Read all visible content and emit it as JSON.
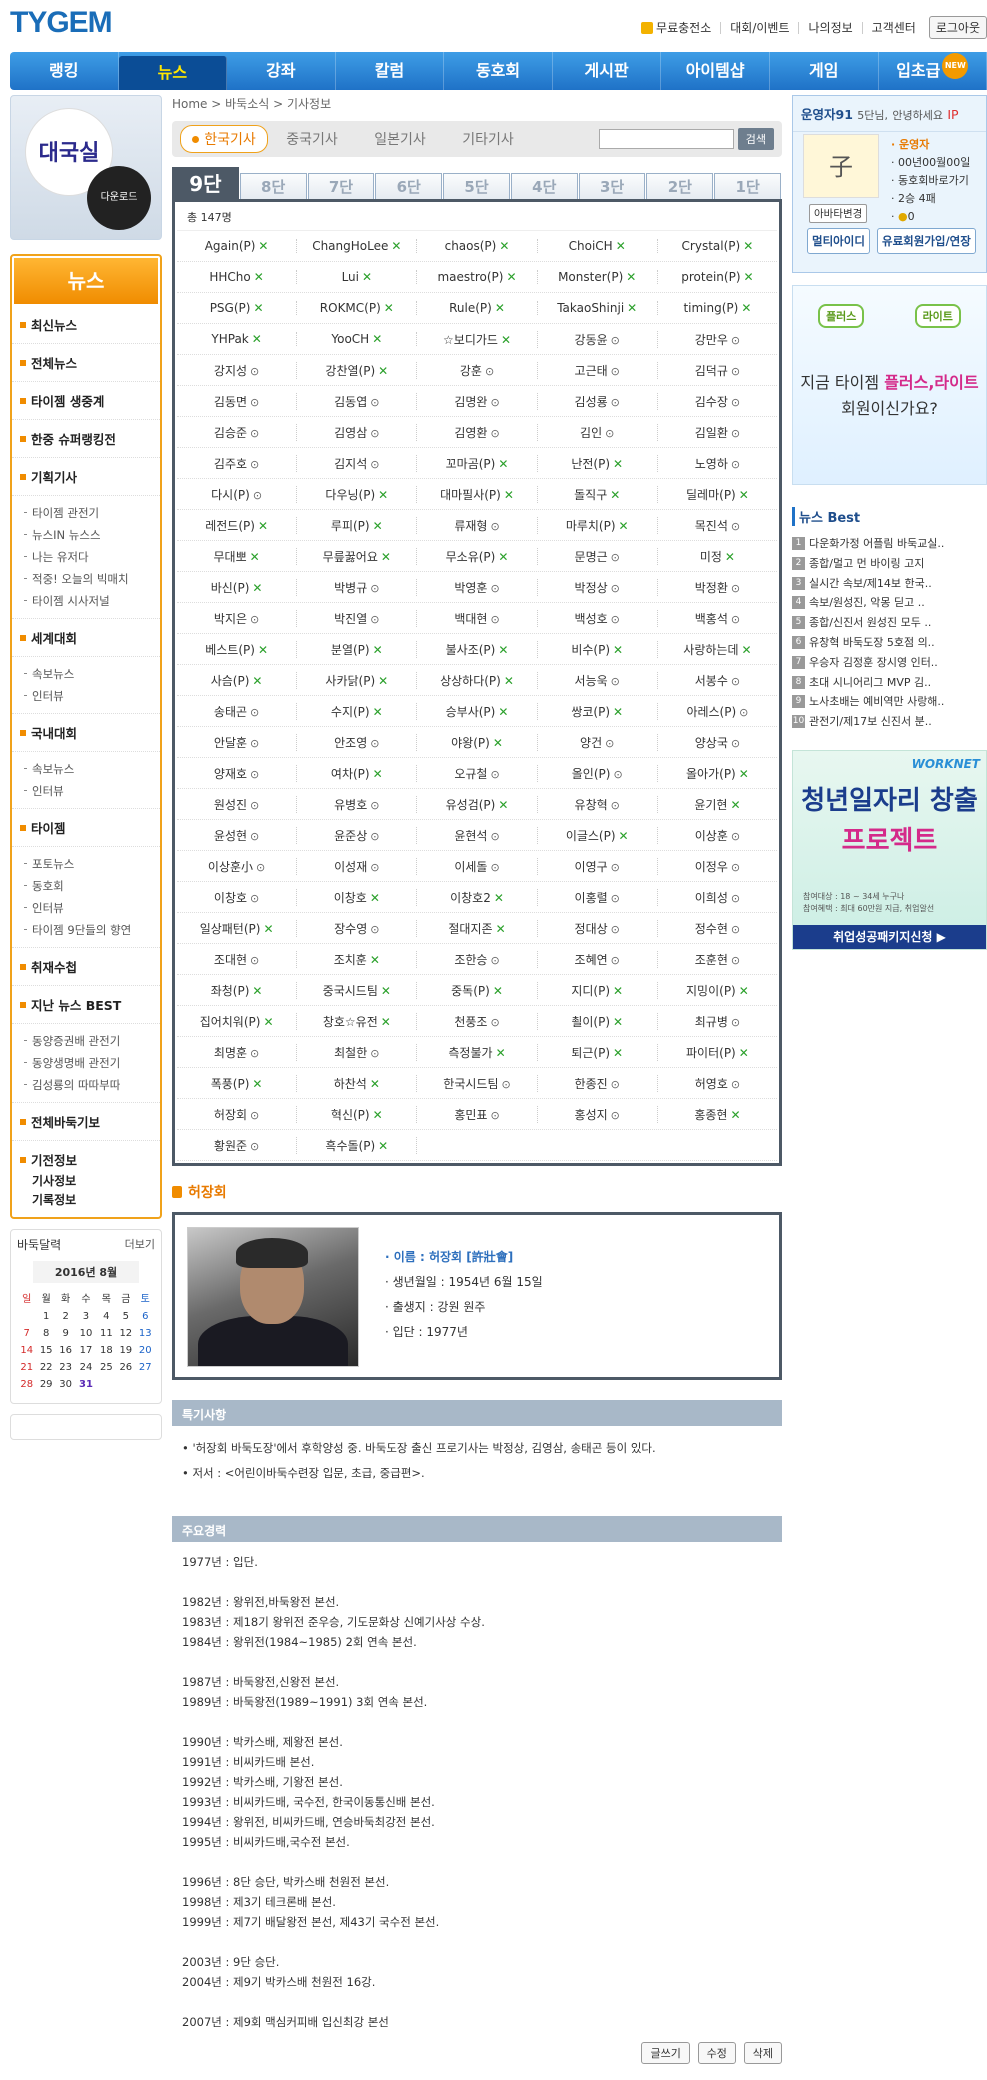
{
  "header": {
    "logo": "TYGEM",
    "links": [
      "무료충전소",
      "대회/이벤트",
      "나의정보",
      "고객센터"
    ],
    "login": "로그아웃"
  },
  "gnb": [
    "랭킹",
    "뉴스",
    "강좌",
    "칼럼",
    "동호회",
    "게시판",
    "아이템샵",
    "게임",
    "입초급"
  ],
  "gnb_new": "NEW",
  "left": {
    "daeguk_title": "대국실",
    "daeguk_download": "다운로드",
    "news_title": "뉴스",
    "categories": {
      "c1": "최신뉴스",
      "c2": "전체뉴스",
      "c3": "타이젬 생중계",
      "c4": "한중 슈퍼랭킹전",
      "c5": "기획기사",
      "c5_subs": [
        "타이젬 관전기",
        "뉴스IN 뉴스스",
        "나는 유저다",
        "적중! 오늘의 빅매치",
        "타이젬 시사저널"
      ],
      "c6": "세계대회",
      "c6_subs": [
        "속보뉴스",
        "인터뷰"
      ],
      "c7": "국내대회",
      "c7_subs": [
        "속보뉴스",
        "인터뷰"
      ],
      "c8": "타이젬",
      "c8_subs": [
        "포토뉴스",
        "동호회",
        "인터뷰",
        "타이젬 9단들의 향연"
      ],
      "c9": "취재수첩",
      "c10": "지난 뉴스 BEST",
      "c10_subs": [
        "동양증권배 관전기",
        "동양생명배 관전기",
        "김성룡의 따따부따"
      ],
      "c11": "전체바둑기보",
      "c12_items": [
        "기전정보",
        "기사정보",
        "기록정보"
      ]
    },
    "calendar": {
      "title": "바둑달력",
      "more": "더보기",
      "month": "2016년 8월",
      "weekdays": [
        "일",
        "월",
        "화",
        "수",
        "목",
        "금",
        "토"
      ],
      "weeks": [
        [
          "",
          "1",
          "2",
          "3",
          "4",
          "5",
          "6"
        ],
        [
          "7",
          "8",
          "9",
          "10",
          "11",
          "12",
          "13"
        ],
        [
          "14",
          "15",
          "16",
          "17",
          "18",
          "19",
          "20"
        ],
        [
          "21",
          "22",
          "23",
          "24",
          "25",
          "26",
          "27"
        ],
        [
          "28",
          "29",
          "30",
          "31",
          "",
          "",
          ""
        ]
      ]
    }
  },
  "main": {
    "breadcrumb": "Home > 바둑소식 > 기사정보",
    "country_tabs": [
      "한국기사",
      "중국기사",
      "일본기사",
      "기타기사"
    ],
    "search_button": "검색",
    "dan_tabs": [
      "9단",
      "8단",
      "7단",
      "6단",
      "5단",
      "4단",
      "3단",
      "2단",
      "1단"
    ],
    "total": "총 147명",
    "players": [
      [
        "Again(P)",
        "x"
      ],
      [
        "ChangHoLee",
        "x"
      ],
      [
        "chaos(P)",
        "x"
      ],
      [
        "ChoiCH",
        "x"
      ],
      [
        "Crystal(P)",
        "x"
      ],
      [
        "HHCho",
        "x"
      ],
      [
        "Lui",
        "x"
      ],
      [
        "maestro(P)",
        "x"
      ],
      [
        "Monster(P)",
        "x"
      ],
      [
        "protein(P)",
        "x"
      ],
      [
        "PSG(P)",
        "x"
      ],
      [
        "ROKMC(P)",
        "x"
      ],
      [
        "Rule(P)",
        "x"
      ],
      [
        "TakaoShinji",
        "x"
      ],
      [
        "timing(P)",
        "x"
      ],
      [
        "YHPak",
        "x"
      ],
      [
        "YooCH",
        "x"
      ],
      [
        "☆보디가드",
        "x"
      ],
      [
        "강동윤",
        "o"
      ],
      [
        "강만우",
        "o"
      ],
      [
        "강지성",
        "o"
      ],
      [
        "강찬열(P)",
        "x"
      ],
      [
        "강훈",
        "o"
      ],
      [
        "고근태",
        "o"
      ],
      [
        "김덕규",
        "o"
      ],
      [
        "김동면",
        "o"
      ],
      [
        "김동엽",
        "o"
      ],
      [
        "김명완",
        "o"
      ],
      [
        "김성룡",
        "o"
      ],
      [
        "김수장",
        "o"
      ],
      [
        "김승준",
        "o"
      ],
      [
        "김영삼",
        "o"
      ],
      [
        "김영환",
        "o"
      ],
      [
        "김인",
        "o"
      ],
      [
        "김일환",
        "o"
      ],
      [
        "김주호",
        "o"
      ],
      [
        "김지석",
        "o"
      ],
      [
        "꼬마곰(P)",
        "x"
      ],
      [
        "난전(P)",
        "x"
      ],
      [
        "노영하",
        "o"
      ],
      [
        "다시(P)",
        "o"
      ],
      [
        "다우닝(P)",
        "x"
      ],
      [
        "대마필사(P)",
        "x"
      ],
      [
        "돌직구",
        "x"
      ],
      [
        "딜레마(P)",
        "x"
      ],
      [
        "레전드(P)",
        "x"
      ],
      [
        "루피(P)",
        "x"
      ],
      [
        "류재형",
        "o"
      ],
      [
        "마루치(P)",
        "x"
      ],
      [
        "목진석",
        "o"
      ],
      [
        "무대뽀",
        "x"
      ],
      [
        "무릎꿇어요",
        "x"
      ],
      [
        "무소유(P)",
        "x"
      ],
      [
        "문명근",
        "o"
      ],
      [
        "미정",
        "x"
      ],
      [
        "바신(P)",
        "x"
      ],
      [
        "박병규",
        "o"
      ],
      [
        "박영훈",
        "o"
      ],
      [
        "박정상",
        "o"
      ],
      [
        "박정환",
        "o"
      ],
      [
        "박지은",
        "o"
      ],
      [
        "박진열",
        "o"
      ],
      [
        "백대현",
        "o"
      ],
      [
        "백성호",
        "o"
      ],
      [
        "백홍석",
        "o"
      ],
      [
        "베스트(P)",
        "x"
      ],
      [
        "분열(P)",
        "x"
      ],
      [
        "불사조(P)",
        "x"
      ],
      [
        "비수(P)",
        "x"
      ],
      [
        "사랑하는데",
        "x"
      ],
      [
        "사슴(P)",
        "x"
      ],
      [
        "사카닭(P)",
        "x"
      ],
      [
        "상상하다(P)",
        "x"
      ],
      [
        "서능욱",
        "o"
      ],
      [
        "서봉수",
        "o"
      ],
      [
        "송태곤",
        "o"
      ],
      [
        "수지(P)",
        "x"
      ],
      [
        "승부사(P)",
        "x"
      ],
      [
        "쌍코(P)",
        "x"
      ],
      [
        "아레스(P)",
        "o"
      ],
      [
        "안달훈",
        "o"
      ],
      [
        "안조영",
        "o"
      ],
      [
        "야왕(P)",
        "x"
      ],
      [
        "양건",
        "o"
      ],
      [
        "양상국",
        "o"
      ],
      [
        "양재호",
        "o"
      ],
      [
        "여차(P)",
        "x"
      ],
      [
        "오규철",
        "o"
      ],
      [
        "올인(P)",
        "o"
      ],
      [
        "올아가(P)",
        "x"
      ],
      [
        "원성진",
        "o"
      ],
      [
        "유병호",
        "o"
      ],
      [
        "유성검(P)",
        "x"
      ],
      [
        "유창혁",
        "o"
      ],
      [
        "윤기현",
        "x"
      ],
      [
        "윤성현",
        "o"
      ],
      [
        "윤준상",
        "o"
      ],
      [
        "윤현석",
        "o"
      ],
      [
        "이글스(P)",
        "x"
      ],
      [
        "이상훈",
        "o"
      ],
      [
        "이상훈小",
        "o"
      ],
      [
        "이성재",
        "o"
      ],
      [
        "이세돌",
        "o"
      ],
      [
        "이영구",
        "o"
      ],
      [
        "이정우",
        "o"
      ],
      [
        "이창호",
        "o"
      ],
      [
        "이창호",
        "x"
      ],
      [
        "이창호2",
        "x"
      ],
      [
        "이홍렬",
        "o"
      ],
      [
        "이희성",
        "o"
      ],
      [
        "일상패턴(P)",
        "x"
      ],
      [
        "장수영",
        "o"
      ],
      [
        "절대지존",
        "x"
      ],
      [
        "정대상",
        "o"
      ],
      [
        "정수현",
        "o"
      ],
      [
        "조대현",
        "o"
      ],
      [
        "조치훈",
        "x"
      ],
      [
        "조한승",
        "o"
      ],
      [
        "조혜연",
        "o"
      ],
      [
        "조훈현",
        "o"
      ],
      [
        "좌청(P)",
        "x"
      ],
      [
        "중국시드팀",
        "x"
      ],
      [
        "중독(P)",
        "x"
      ],
      [
        "지디(P)",
        "x"
      ],
      [
        "지밍이(P)",
        "x"
      ],
      [
        "집어치워(P)",
        "x"
      ],
      [
        "창호☆유전",
        "x"
      ],
      [
        "천풍조",
        "o"
      ],
      [
        "쵤이(P)",
        "x"
      ],
      [
        "최규병",
        "o"
      ],
      [
        "최명훈",
        "o"
      ],
      [
        "최철한",
        "o"
      ],
      [
        "측정불가",
        "x"
      ],
      [
        "퇴근(P)",
        "x"
      ],
      [
        "파이터(P)",
        "x"
      ],
      [
        "폭풍(P)",
        "x"
      ],
      [
        "하찬석",
        "x"
      ],
      [
        "한국시드팀",
        "o"
      ],
      [
        "한종진",
        "o"
      ],
      [
        "허영호",
        "o"
      ],
      [
        "허장회",
        "o"
      ],
      [
        "혁신(P)",
        "x"
      ],
      [
        "홍민표",
        "o"
      ],
      [
        "홍성지",
        "o"
      ],
      [
        "홍종현",
        "x"
      ],
      [
        "황원준",
        "o"
      ],
      [
        "흑수돌(P)",
        "x"
      ]
    ],
    "profile": {
      "title": "허장회",
      "name": "· 이름 : 허장회 [許壯會]",
      "birth": "· 생년월일 : 1954년 6월 15일",
      "birthplace": "· 출생지 : 강원 원주",
      "debut": "· 입단 : 1977년"
    },
    "features_title": "특기사항",
    "features": [
      "• '허장회 바둑도장'에서 후학양성 중. 바둑도장 출신 프로기사는 박정상, 김영삼, 송태곤 등이 있다.",
      "• 저서 : <어린이바둑수련장 입문, 초급, 중급편>."
    ],
    "career_title": "주요경력",
    "career": [
      [
        "1977년 : 입단."
      ],
      [
        "1982년 : 왕위전,바둑왕전 본선.",
        "1983년 : 제18기 왕위전 준우승, 기도문화상 신예기사상 수상.",
        "1984년 : 왕위전(1984~1985) 2회 연속 본선."
      ],
      [
        "1987년 : 바둑왕전,신왕전 본선.",
        "1989년 : 바둑왕전(1989~1991) 3회 연속 본선."
      ],
      [
        "1990년 : 박카스배, 제왕전 본선.",
        "1991년 : 비씨카드배 본선.",
        "1992년 : 박카스배, 기왕전 본선.",
        "1993년 : 비씨카드배, 국수전, 한국이동통신배 본선.",
        "1994년 : 왕위전, 비씨카드배, 연승바둑최강전 본선.",
        "1995년 : 비씨카드배,국수전 본선."
      ],
      [
        "1996년 : 8단 승단, 박카스배 천원전 본선.",
        "1998년 : 제3기 테크론배 본선.",
        "1999년 : 제7기 배달왕전 본선, 제43기 국수전 본선."
      ],
      [
        "2003년 : 9단 승단.",
        "2004년 : 제9기 박카스배 천원전 16강."
      ],
      [
        "2007년 : 제9회 맥심커피배 입신최강 본선"
      ]
    ],
    "actions": [
      "글쓰기",
      "수정",
      "삭제"
    ]
  },
  "right": {
    "user": {
      "id": "운영자91",
      "dan": "5단님,",
      "greeting": "안녕하세요",
      "ip": "IP",
      "grade": "운영자",
      "date": "00년00월00일",
      "club": "동호회바로가기",
      "record": "2승 4패",
      "coins": "0",
      "avatar_btn": "아바타변경",
      "btn1": "멀티아이디",
      "btn2": "유료회원가입/연장"
    },
    "ad1": {
      "chip1": "플러스",
      "chip2": "라이트",
      "line1_a": "지금 타이젬 ",
      "line1_b": "플러스,라이트",
      "line2": "회원이신가요?"
    },
    "best_title": "뉴스 Best",
    "best": [
      "다운화가정 어플림 바둑교실..",
      "종합/멀고 먼 바이링 고지",
      "실시간 속보/제14보 한국..",
      "속보/원성진, 악몽 딛고 ..",
      "종합/신진서 원성진 모두 ..",
      "유창혁 바둑도장 5호점 의..",
      "우승자 김정훈 장시영 인터..",
      "초대 시니어리그 MVP 김..",
      "노사초배는 예비역만 사랑해..",
      "관전기/제17보 신진서 분.."
    ],
    "ad2": {
      "brand": "WORKNET",
      "line1": "청년일자리 창출",
      "line2": "프로젝트",
      "small1": "참여대상 : 18 ~ 34세 누구나",
      "small2": "참여혜택 : 최대 60만원 지급, 취업알선",
      "bar": "취업성공패키지신청 ▶"
    }
  }
}
